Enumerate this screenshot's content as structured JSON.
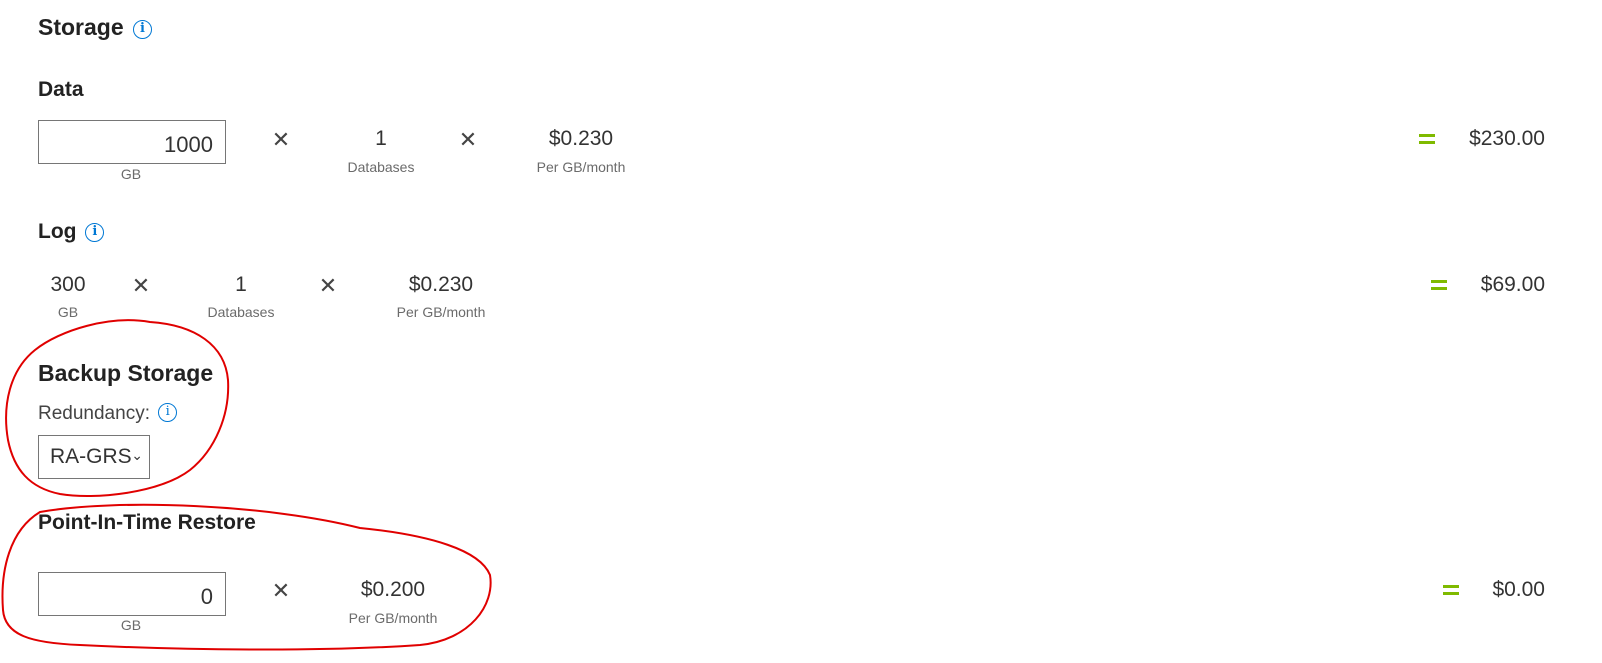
{
  "storage": {
    "title": "Storage",
    "info_icon": "i"
  },
  "data": {
    "title": "Data",
    "size_value": "1000",
    "size_unit": "GB",
    "databases_value": "1",
    "databases_label": "Databases",
    "price": "$0.230",
    "price_unit": "Per GB/month",
    "total": "$230.00"
  },
  "log": {
    "title": "Log",
    "info_icon": "i",
    "size_value": "300",
    "size_unit": "GB",
    "databases_value": "1",
    "databases_label": "Databases",
    "price": "$0.230",
    "price_unit": "Per GB/month",
    "total": "$69.00"
  },
  "backup": {
    "title": "Backup Storage",
    "redundancy_label": "Redundancy:",
    "info_icon": "i",
    "redundancy_selected": "RA-GRS"
  },
  "pitr": {
    "title": "Point-In-Time Restore",
    "size_value": "0",
    "size_unit": "GB",
    "price": "$0.200",
    "price_unit": "Per GB/month",
    "total": "$0.00"
  },
  "symbols": {
    "times": "✕"
  },
  "colors": {
    "accent_blue": "#0078d4",
    "equals_green": "#7fba00",
    "annotation_red": "#e00000"
  }
}
